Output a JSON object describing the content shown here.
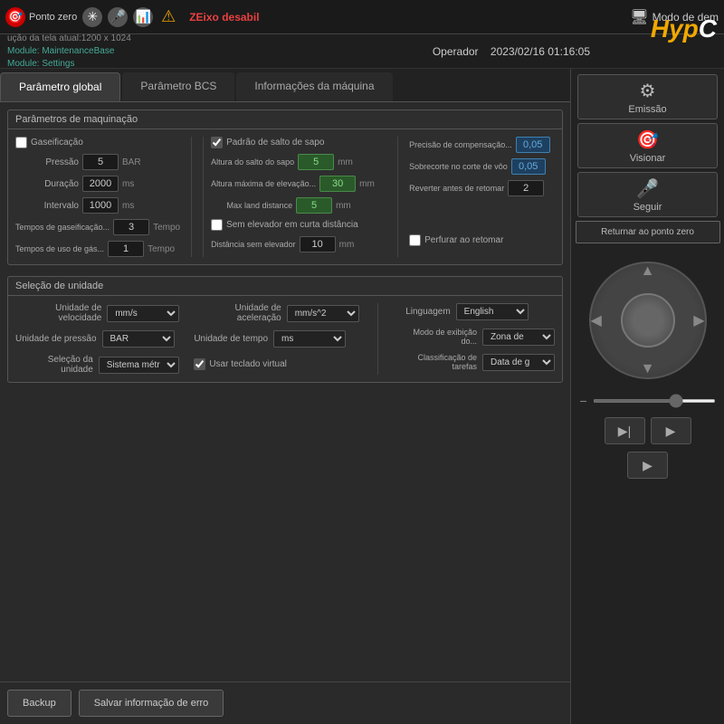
{
  "topbar": {
    "ponto_zero": "Ponto zero",
    "zeixo": "ZEixo desabil",
    "modo_dem": "Modo de dem",
    "icons": [
      "🎯",
      "✳",
      "🎤",
      "📊",
      "🔔"
    ]
  },
  "logo": {
    "text": "HypC"
  },
  "subtitle": {
    "resolution": "ução da tela atual:1200 x 1024",
    "module1": "Module: MaintenanceBase",
    "module2": "Module: Settings",
    "operator": "Operador",
    "datetime": "2023/02/16 01:16:05"
  },
  "tabs": {
    "items": [
      {
        "label": "Parâmetro global",
        "active": true
      },
      {
        "label": "Parâmetro BCS",
        "active": false
      },
      {
        "label": "Informações da máquina",
        "active": false
      }
    ]
  },
  "maquinacao": {
    "title": "Parâmetros de maquinação",
    "gaseificacao": "Gaseificação",
    "pressao_label": "Pressão",
    "pressao_value": "5",
    "pressao_unit": "BAR",
    "duracao_label": "Duração",
    "duracao_value": "2000",
    "duracao_unit": "ms",
    "intervalo_label": "Intervalo",
    "intervalo_value": "1000",
    "intervalo_unit": "ms",
    "tempos_gas_label": "Tempos de gaseificação...",
    "tempos_gas_value": "3",
    "tempos_gas_unit": "Tempo",
    "tempos_uso_label": "Tempos de uso de gás...",
    "tempos_uso_value": "1",
    "tempos_uso_unit": "Tempo",
    "padrao_label": "Padrão de salto de sapo",
    "altura_salto_label": "Altura do salto do sapo",
    "altura_salto_value": "5",
    "altura_salto_unit": "mm",
    "altura_max_label": "Altura máxima de elevação...",
    "altura_max_value": "30",
    "altura_max_unit": "mm",
    "max_land_label": "Max land distance",
    "max_land_value": "5",
    "max_land_unit": "mm",
    "sem_elevador_label": "Sem elevador em curta distância",
    "dist_sem_label": "Distância sem elevador",
    "dist_sem_value": "10",
    "dist_sem_unit": "mm",
    "precisao_label": "Precisão de compensação...",
    "precisao_value": "0,05",
    "sobrecorte_label": "Sobrecorte no corte de vôo",
    "sobrecorte_value": "0,05",
    "reverter_label": "Reverter antes de retomar",
    "reverter_value": "2",
    "perfurar_label": "Perfurar ao retomar"
  },
  "unidade": {
    "title": "Seleção de unidade",
    "velocidade_label": "Unidade de velocidade",
    "velocidade_value": "mm/s",
    "aceleracao_label": "Unidade de aceleração",
    "aceleracao_value": "mm/s^2",
    "pressao_label": "Unidade de pressão",
    "pressao_value": "BAR",
    "tempo_label": "Unidade de tempo",
    "tempo_value": "ms",
    "selecao_label": "Seleção da unidade",
    "selecao_value": "Sistema métri",
    "teclado_label": "Usar teclado virtual",
    "linguagem_label": "Linguagem",
    "linguagem_value": "English",
    "modo_exibicao_label": "Modo de exibição do...",
    "modo_exibicao_value": "Zona de",
    "classificacao_label": "Classificação de tarefas",
    "classificacao_value": "Data de g"
  },
  "rightpanel": {
    "emissao": "Emissão",
    "visionar": "Visionar",
    "seguir": "Seguir",
    "returnar": "Returnar ao ponto zero"
  },
  "bottom": {
    "backup": "Backup",
    "salvar": "Salvar informação de erro"
  }
}
